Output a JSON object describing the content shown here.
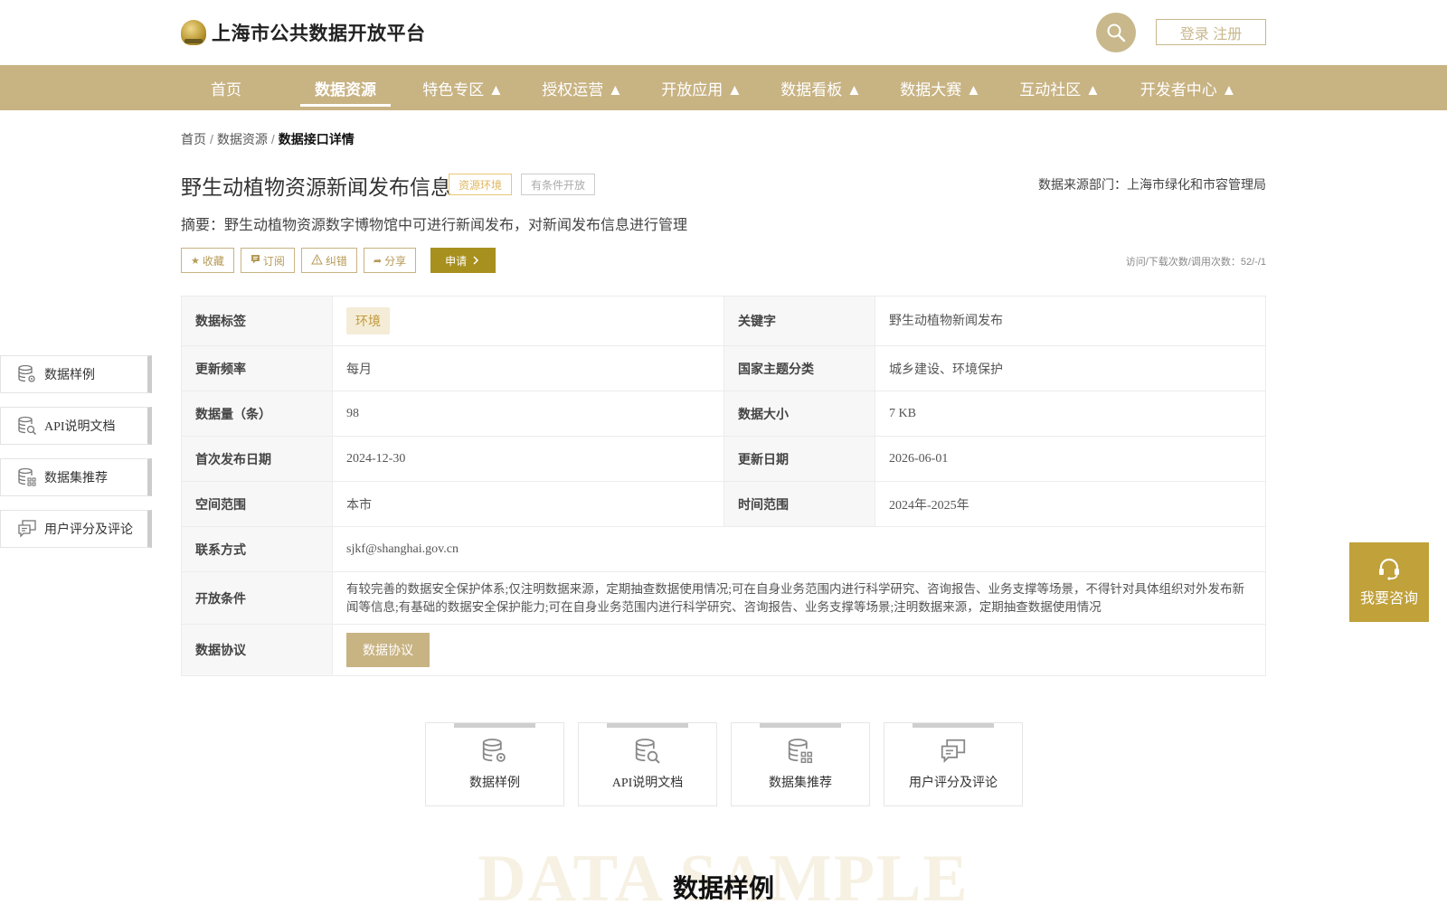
{
  "header": {
    "site_title": "上海市公共数据开放平台",
    "login_label": "登录 注册"
  },
  "nav": {
    "items": [
      {
        "label": "首页"
      },
      {
        "label": "数据资源"
      },
      {
        "label": "特色专区 ▲"
      },
      {
        "label": "授权运营 ▲"
      },
      {
        "label": "开放应用 ▲"
      },
      {
        "label": "数据看板 ▲"
      },
      {
        "label": "数据大赛 ▲"
      },
      {
        "label": "互动社区 ▲"
      },
      {
        "label": "开发者中心 ▲"
      }
    ]
  },
  "breadcrumb": {
    "home": "首页",
    "sep": "/",
    "resources": "数据资源",
    "current": "数据接口详情"
  },
  "dataset": {
    "title": "野生动植物资源新闻发布信息",
    "tag_category": "资源环境",
    "tag_open": "有条件开放",
    "source_dept": "数据来源部门：上海市绿化和市容管理局",
    "abstract": "摘要：野生动植物资源数字博物馆中可进行新闻发布，对新闻发布信息进行管理",
    "stats": "访问/下载次数/调用次数：52/-/1"
  },
  "actions": {
    "collect": "收藏",
    "subscribe": "订阅",
    "correct": "纠错",
    "share": "分享",
    "apply": "申请"
  },
  "table": {
    "tag_label": "数据标签",
    "tag_value": "环境",
    "keyword_label": "关键字",
    "keyword_value": "野生动植物新闻发布",
    "freq_label": "更新频率",
    "freq_value": "每月",
    "theme_label": "国家主题分类",
    "theme_value": "城乡建设、环境保护",
    "count_label": "数据量（条）",
    "count_value": "98",
    "size_label": "数据大小",
    "size_value": "7 KB",
    "first_pub_label": "首次发布日期",
    "first_pub_value": "2024-12-30",
    "update_label": "更新日期",
    "update_value": "2026-06-01",
    "space_label": "空间范围",
    "space_value": "本市",
    "time_label": "时间范围",
    "time_value": "2024年-2025年",
    "contact_label": "联系方式",
    "contact_value": "sjkf@shanghai.gov.cn",
    "condition_label": "开放条件",
    "condition_value": "有较完善的数据安全保护体系;仅注明数据来源，定期抽查数据使用情况;可在自身业务范围内进行科学研究、咨询报告、业务支撑等场景，不得针对具体组织对外发布新闻等信息;有基础的数据安全保护能力;可在自身业务范围内进行科学研究、咨询报告、业务支撑等场景;注明数据来源，定期抽查数据使用情况",
    "protocol_label": "数据协议",
    "protocol_button": "数据协议"
  },
  "side_nav": {
    "items": [
      {
        "label": "数据样例"
      },
      {
        "label": "API说明文档"
      },
      {
        "label": "数据集推荐"
      },
      {
        "label": "用户评分及评论"
      }
    ]
  },
  "consult": {
    "label": "我要咨询"
  },
  "cards": {
    "items": [
      {
        "label": "数据样例"
      },
      {
        "label": "API说明文档"
      },
      {
        "label": "数据集推荐"
      },
      {
        "label": "用户评分及评论"
      }
    ]
  },
  "section": {
    "bg_text": "DATA SAMPLE",
    "title": "数据样例"
  },
  "colors": {
    "brand_gold": "#c8b383",
    "apply_olive": "#a8901e",
    "consult_gold": "#c0a13a"
  },
  "icons": {
    "search": "search-icon",
    "database_gear": "database-gear-icon",
    "database_search": "database-search-icon",
    "database_grid": "database-grid-icon",
    "comment": "comment-icon",
    "headset": "headset-icon"
  }
}
